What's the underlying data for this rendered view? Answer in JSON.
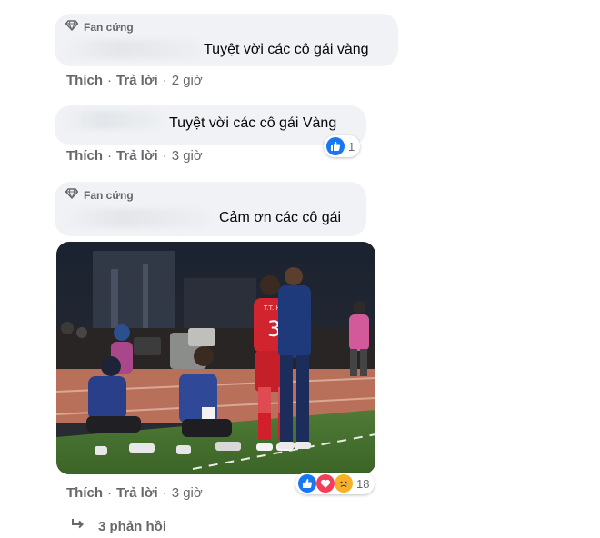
{
  "comments": [
    {
      "badge": "Fan cứng",
      "text": "Tuyệt vời các cô gái vàng",
      "like": "Thích",
      "reply": "Trả lời",
      "time": "2 giờ"
    },
    {
      "text": "Tuyệt vời các cô gái Vàng",
      "like": "Thích",
      "reply": "Trả lời",
      "time": "3 giờ",
      "reaction_count": "1",
      "reactions": [
        "like-icon"
      ]
    },
    {
      "badge": "Fan cứng",
      "text": "Cảm ơn các cô gái",
      "like": "Thích",
      "reply": "Trả lời",
      "time": "3 giờ",
      "reaction_count": "18",
      "reactions": [
        "like-icon",
        "love-icon",
        "sad-icon"
      ],
      "photo": {
        "jersey_name": "T.T. HẢI",
        "jersey_number": "3"
      }
    }
  ],
  "separator": "·",
  "view_replies": "3 phản hồi",
  "colors": {
    "bubble": "#f0f2f5",
    "meta_text": "#65676b",
    "like_blue": "#1877f2",
    "love_red": "#f33e58",
    "sad_yellow": "#f7b125"
  }
}
